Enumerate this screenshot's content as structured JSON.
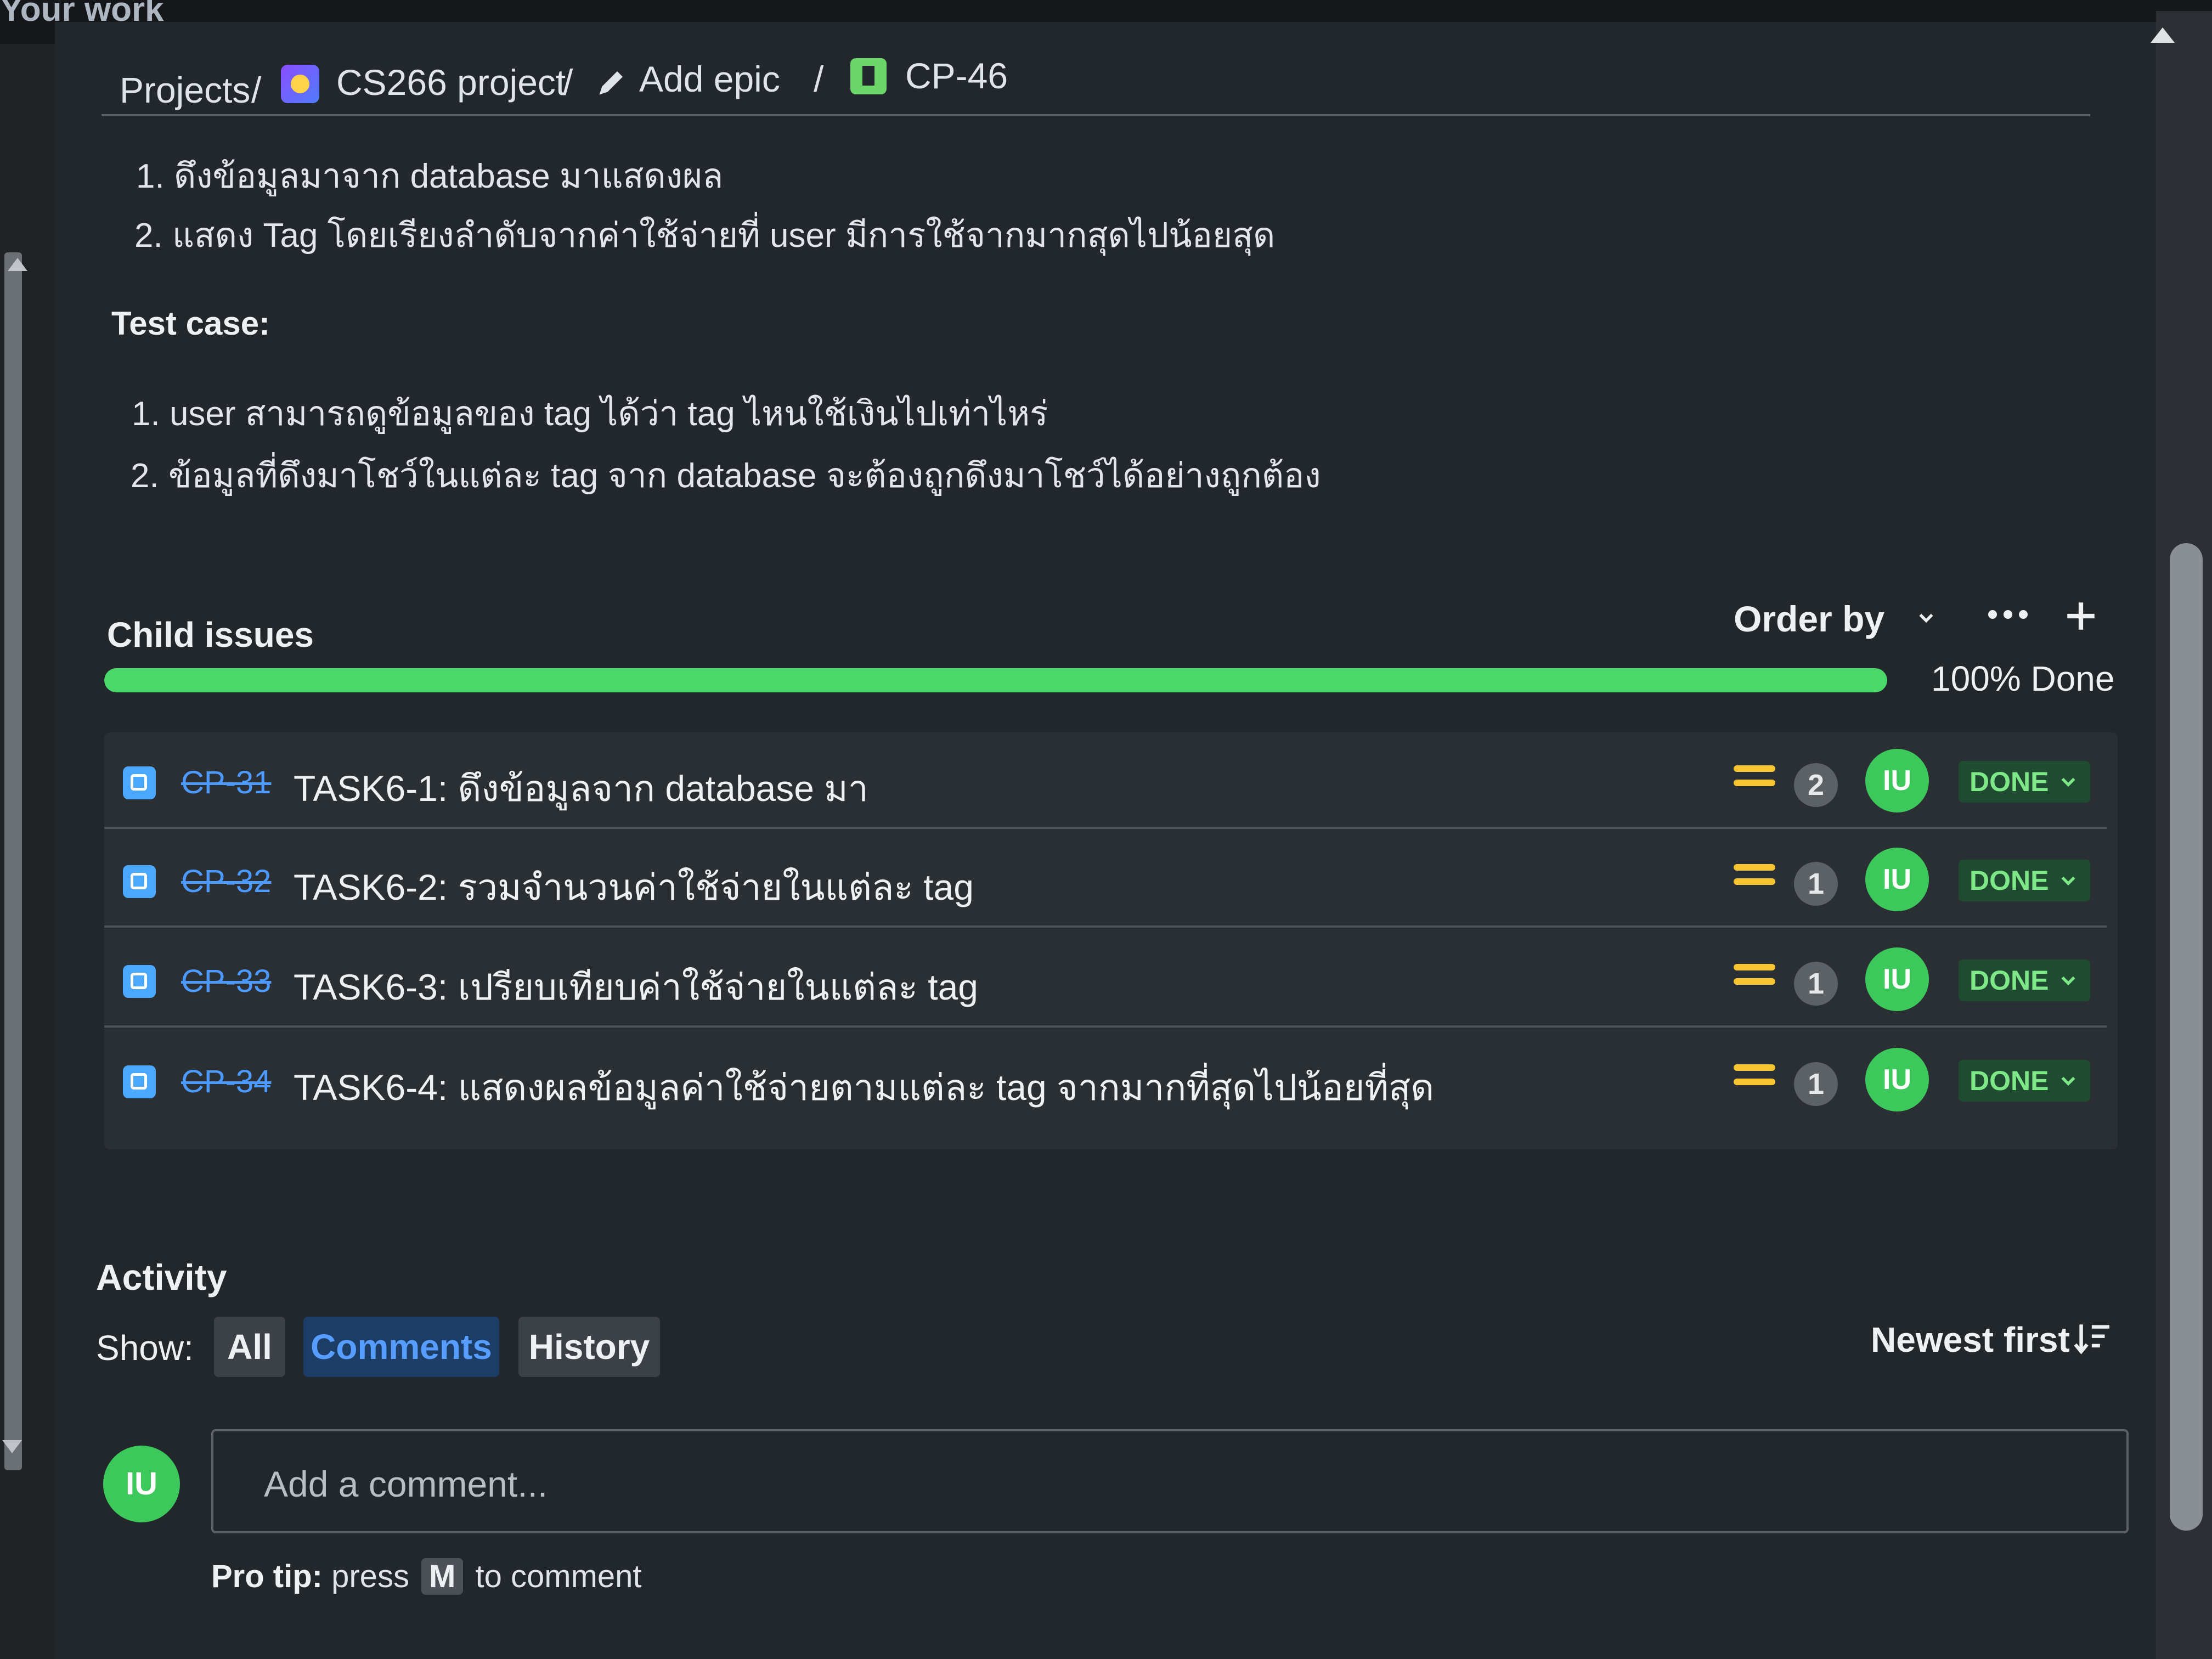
{
  "top_nav": {
    "your_work": "Your work"
  },
  "breadcrumb": {
    "projects": "Projects",
    "project": "CS266 project",
    "epic": "Add epic",
    "issue": "CP-46",
    "separator": "/"
  },
  "description": {
    "steps": [
      {
        "num": "1.",
        "text": "ดึงข้อมูลมาจาก database มาแสดงผล"
      },
      {
        "num": "2.",
        "text": "แสดง Tag โดยเรียงลำดับจากค่าใช้จ่ายที่ user มีการใช้จากมากสุดไปน้อยสุด"
      }
    ],
    "test_case_heading": "Test case:",
    "test_cases": [
      {
        "num": "1.",
        "text": "user สามารถดูข้อมูลของ tag ได้ว่า tag ไหนใช้เงินไปเท่าไหร่"
      },
      {
        "num": "2.",
        "text": "ข้อมูลที่ดึงมาโชว์ในแต่ละ tag จาก database จะต้องถูกดึงมาโชว์ได้อย่างถูกต้อง"
      }
    ]
  },
  "child_issues": {
    "title": "Child issues",
    "order_by": "Order by",
    "progress_percent": 100,
    "progress_label": "100% Done",
    "items": [
      {
        "key": "CP-31",
        "summary": "TASK6-1: ดึงข้อมูลจาก database มา",
        "count": "2",
        "assignee": "IU",
        "status": "DONE"
      },
      {
        "key": "CP-32",
        "summary": "TASK6-2: รวมจำนวนค่าใช้จ่ายในแต่ละ tag",
        "count": "1",
        "assignee": "IU",
        "status": "DONE"
      },
      {
        "key": "CP-33",
        "summary": "TASK6-3: เปรียบเทียบค่าใช้จ่ายในแต่ละ tag",
        "count": "1",
        "assignee": "IU",
        "status": "DONE"
      },
      {
        "key": "CP-34",
        "summary": "TASK6-4: แสดงผลข้อมูลค่าใช้จ่ายตามแต่ละ tag จากมากที่สุดไปน้อยที่สุด",
        "count": "1",
        "assignee": "IU",
        "status": "DONE"
      }
    ]
  },
  "activity": {
    "title": "Activity",
    "show_label": "Show:",
    "tabs": [
      "All",
      "Comments",
      "History"
    ],
    "active_tab": "Comments",
    "sort_label": "Newest first",
    "comment_avatar": "IU",
    "comment_placeholder": "Add a comment...",
    "pro_tip_prefix": "Pro tip:",
    "pro_tip_press": "press",
    "pro_tip_key": "M",
    "pro_tip_suffix": "to comment"
  },
  "colors": {
    "accent": "#579dff",
    "progress": "#4bd86a",
    "done_bg": "#1f4b30",
    "done_text": "#7ee787",
    "priority": "#f7c531",
    "avatar": "#3cc85a"
  },
  "icons": {
    "project": "project-avatar-icon",
    "epic": "pencil-icon",
    "issue": "story-icon",
    "task": "subtask-icon",
    "priority": "priority-medium-icon",
    "more": "more-horizontal-icon",
    "add": "plus-icon",
    "sort": "sort-descending-icon"
  }
}
